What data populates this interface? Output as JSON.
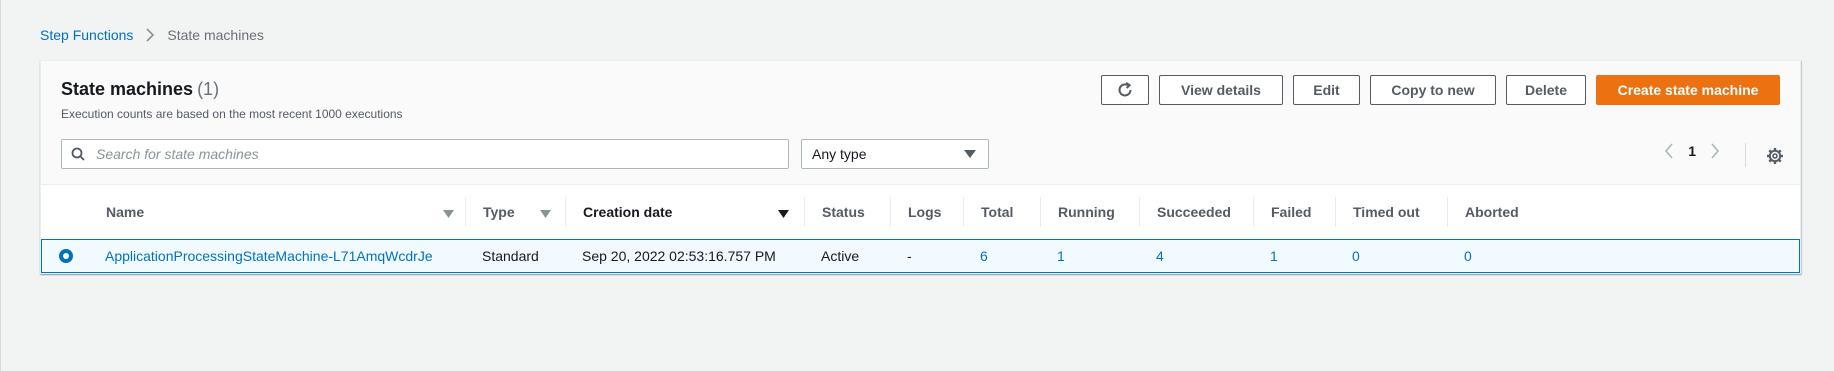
{
  "breadcrumb": {
    "root": "Step Functions",
    "current": "State machines"
  },
  "panel": {
    "title": "State machines",
    "count": "(1)",
    "subtitle": "Execution counts are based on the most recent 1000 executions"
  },
  "actions": {
    "refresh_icon": "refresh-icon",
    "view_details": "View details",
    "edit": "Edit",
    "copy_to_new": "Copy to new",
    "delete": "Delete",
    "create": "Create state machine"
  },
  "search": {
    "placeholder": "Search for state machines",
    "value": ""
  },
  "type_filter": {
    "selected": "Any type"
  },
  "pagination": {
    "current_page": "1"
  },
  "table": {
    "columns": {
      "name": "Name",
      "type": "Type",
      "creation_date": "Creation date",
      "status": "Status",
      "logs": "Logs",
      "total": "Total",
      "running": "Running",
      "succeeded": "Succeeded",
      "failed": "Failed",
      "timed_out": "Timed out",
      "aborted": "Aborted"
    },
    "rows": [
      {
        "selected": true,
        "name": "ApplicationProcessingStateMachine-L71AmqWcdrJe",
        "type": "Standard",
        "creation_date": "Sep 20, 2022 02:53:16.757 PM",
        "status": "Active",
        "logs": "-",
        "total": "6",
        "running": "1",
        "succeeded": "4",
        "failed": "1",
        "timed_out": "0",
        "aborted": "0"
      }
    ]
  },
  "colors": {
    "link": "#0073bb",
    "primary": "#ec7211",
    "selected_row_bg": "#f1faff"
  }
}
